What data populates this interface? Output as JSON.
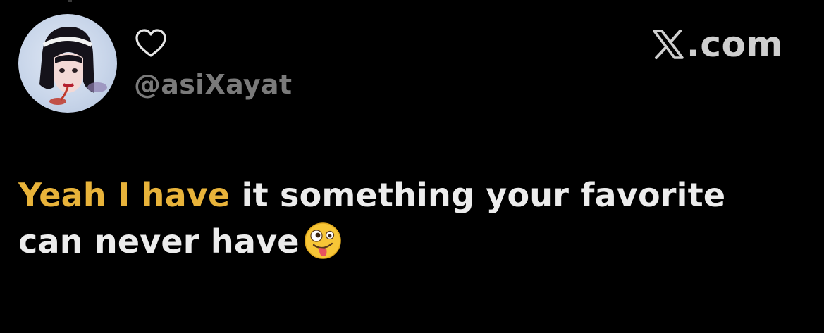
{
  "tweet": {
    "author_handle": "@asiXayat",
    "site_label": ".com",
    "icons": {
      "like": "heart-outline-icon",
      "brand": "x-logo-icon",
      "reaction": "zany-face-emoji"
    },
    "text_highlight": "Yeah I have",
    "text_rest": " it something your favorite can never have"
  },
  "colors": {
    "background": "#000000",
    "highlight": "#e8b33a",
    "handle": "#7a7a7a",
    "text": "#ececec"
  }
}
